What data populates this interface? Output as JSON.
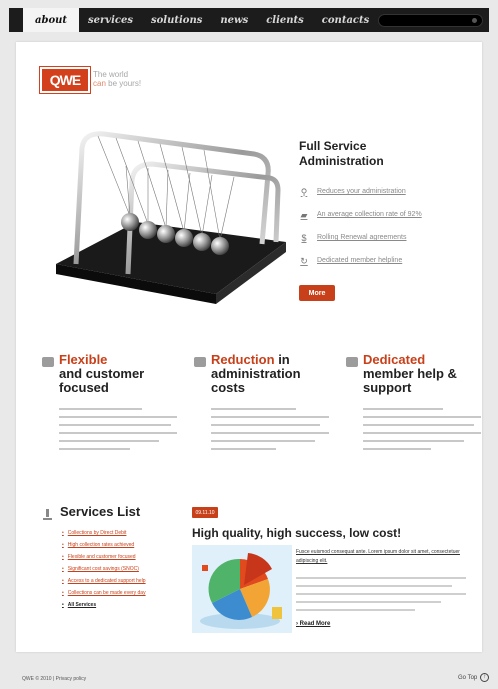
{
  "nav": {
    "items": [
      "about",
      "services",
      "solutions",
      "news",
      "clients",
      "contacts"
    ],
    "active": "about"
  },
  "logo": {
    "text": "QWE",
    "tagline_line1": "The world",
    "tagline_line2_accent": "can",
    "tagline_line2_rest": "be yours!"
  },
  "hero": {
    "title": "Full Service Administration",
    "features": [
      {
        "icon": "magnifier-icon",
        "label": "Reduces your administration"
      },
      {
        "icon": "car-icon",
        "label": "An average collection rate of 92%"
      },
      {
        "icon": "dollar-icon",
        "label": "Rolling Renewal agreements"
      },
      {
        "icon": "refresh-icon",
        "label": "Dedicated member helpline"
      }
    ],
    "more_label": "More"
  },
  "columns": [
    {
      "icon": "document-icon",
      "highlight": "Flexible",
      "rest": "and customer focused"
    },
    {
      "icon": "pushpin-icon",
      "highlight": "Reduction",
      "rest_inline": "in",
      "rest": "administration costs"
    },
    {
      "icon": "users-icon",
      "highlight": "Dedicated",
      "rest": "member help & support"
    }
  ],
  "services": {
    "title": "Services List",
    "items": [
      "Collections by Direct Debit",
      "High collection rates achieved",
      "Flexible and customer focused",
      "Significant cost savings (SNOC)",
      "Access to a dedicated support help",
      "Collections can be made every day"
    ],
    "all_label": "All Services"
  },
  "news": {
    "badge": "09.11.10",
    "title": "High quality, high success, low cost!",
    "link": "Fusce euismod consequat ante. Lorem ipsum dolor sit amet, consectetuer adipiscing elit.",
    "read_more": "Read More"
  },
  "footer": {
    "copyright": "QWE © 2010 | Privacy policy",
    "go_top": "Go Top"
  }
}
